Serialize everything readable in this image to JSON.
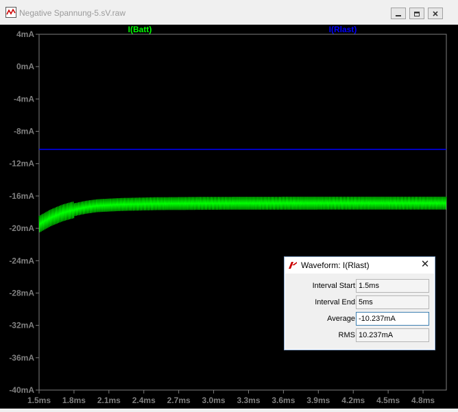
{
  "window": {
    "title": "Negative Spannung-5.sV.raw"
  },
  "legend": {
    "trace1": "I(Batt)",
    "trace2": "I(Rlast)"
  },
  "colors": {
    "trace1": "#00ff00",
    "trace2": "#0000ff",
    "background": "#000000",
    "axis": "#808080"
  },
  "chart_data": {
    "type": "line",
    "x_ticks": [
      "1.5ms",
      "1.8ms",
      "2.1ms",
      "2.4ms",
      "2.7ms",
      "3.0ms",
      "3.3ms",
      "3.6ms",
      "3.9ms",
      "4.2ms",
      "4.5ms",
      "4.8ms"
    ],
    "y_ticks": [
      "4mA",
      "0mA",
      "-4mA",
      "-8mA",
      "-12mA",
      "-16mA",
      "-20mA",
      "-24mA",
      "-28mA",
      "-32mA",
      "-36mA",
      "-40mA"
    ],
    "xlim": [
      1.5,
      5.0
    ],
    "ylim": [
      -40,
      4
    ],
    "x_unit": "ms",
    "y_unit": "mA",
    "series": [
      {
        "name": "I(Batt)",
        "color": "#00ff00",
        "samples": [
          [
            1.5,
            -19.5
          ],
          [
            1.6,
            -18.7
          ],
          [
            1.7,
            -18.1
          ],
          [
            1.8,
            -17.7
          ],
          [
            1.9,
            -17.4
          ],
          [
            2.0,
            -17.2
          ],
          [
            2.2,
            -17.05
          ],
          [
            2.5,
            -16.95
          ],
          [
            3.0,
            -16.9
          ],
          [
            4.0,
            -16.88
          ],
          [
            5.0,
            -16.88
          ]
        ],
        "ripple_mA": 1.6
      },
      {
        "name": "I(Rlast)",
        "color": "#0000ff",
        "samples": [
          [
            1.5,
            -10.237
          ],
          [
            5.0,
            -10.237
          ]
        ]
      }
    ]
  },
  "dialog": {
    "title": "Waveform: I(Rlast)",
    "close": "✕",
    "rows": [
      {
        "label": "Interval Start:",
        "value": "1.5ms"
      },
      {
        "label": "Interval End:",
        "value": "5ms"
      },
      {
        "label": "Average:",
        "value": "-10.237mA"
      },
      {
        "label": "RMS:",
        "value": "10.237mA"
      }
    ]
  }
}
